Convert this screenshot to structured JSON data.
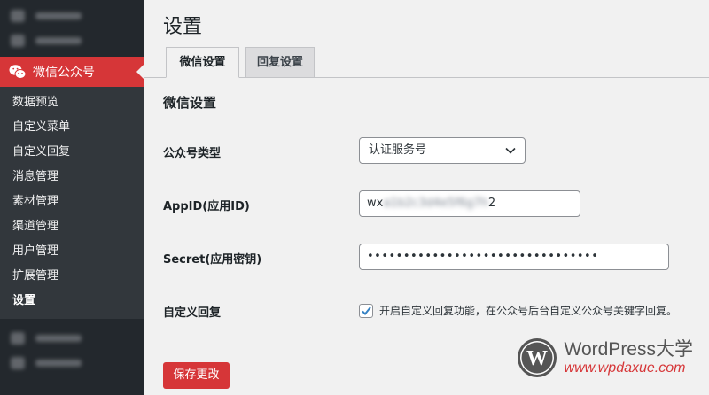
{
  "sidebar": {
    "active_menu_label": "微信公众号",
    "submenu": [
      {
        "label": "数据预览"
      },
      {
        "label": "自定义菜单"
      },
      {
        "label": "自定义回复"
      },
      {
        "label": "消息管理"
      },
      {
        "label": "素材管理"
      },
      {
        "label": "渠道管理"
      },
      {
        "label": "用户管理"
      },
      {
        "label": "扩展管理"
      },
      {
        "label": "设置"
      }
    ]
  },
  "page": {
    "title": "设置",
    "tabs": [
      {
        "label": "微信设置"
      },
      {
        "label": "回复设置"
      }
    ],
    "section_title": "微信设置"
  },
  "form": {
    "account_type_label": "公众号类型",
    "account_type_value": "认证服务号",
    "appid_label": "AppID(应用ID)",
    "appid_value_start": "wx",
    "appid_value_end": "2",
    "secret_label": "Secret(应用密钥)",
    "secret_value": "••••••••••••••••••••••••••••••••",
    "auto_reply_label": "自定义回复",
    "auto_reply_checkbox_label": "开启自定义回复功能，在公众号后台自定义公众号关键字回复。",
    "auto_reply_checked": true,
    "save_button": "保存更改"
  },
  "watermark": {
    "title": "WordPress大学",
    "url": "www.wpdaxue.com"
  },
  "colors": {
    "accent": "#d63638",
    "sidebar_bg": "#23282d",
    "submenu_bg": "#32373c",
    "page_bg": "#f1f1f1"
  },
  "icons": {
    "active_menu": "wechat-icon",
    "select": "chevron-down-icon",
    "checkbox": "checkmark-icon",
    "watermark": "wordpress-logo-icon"
  }
}
